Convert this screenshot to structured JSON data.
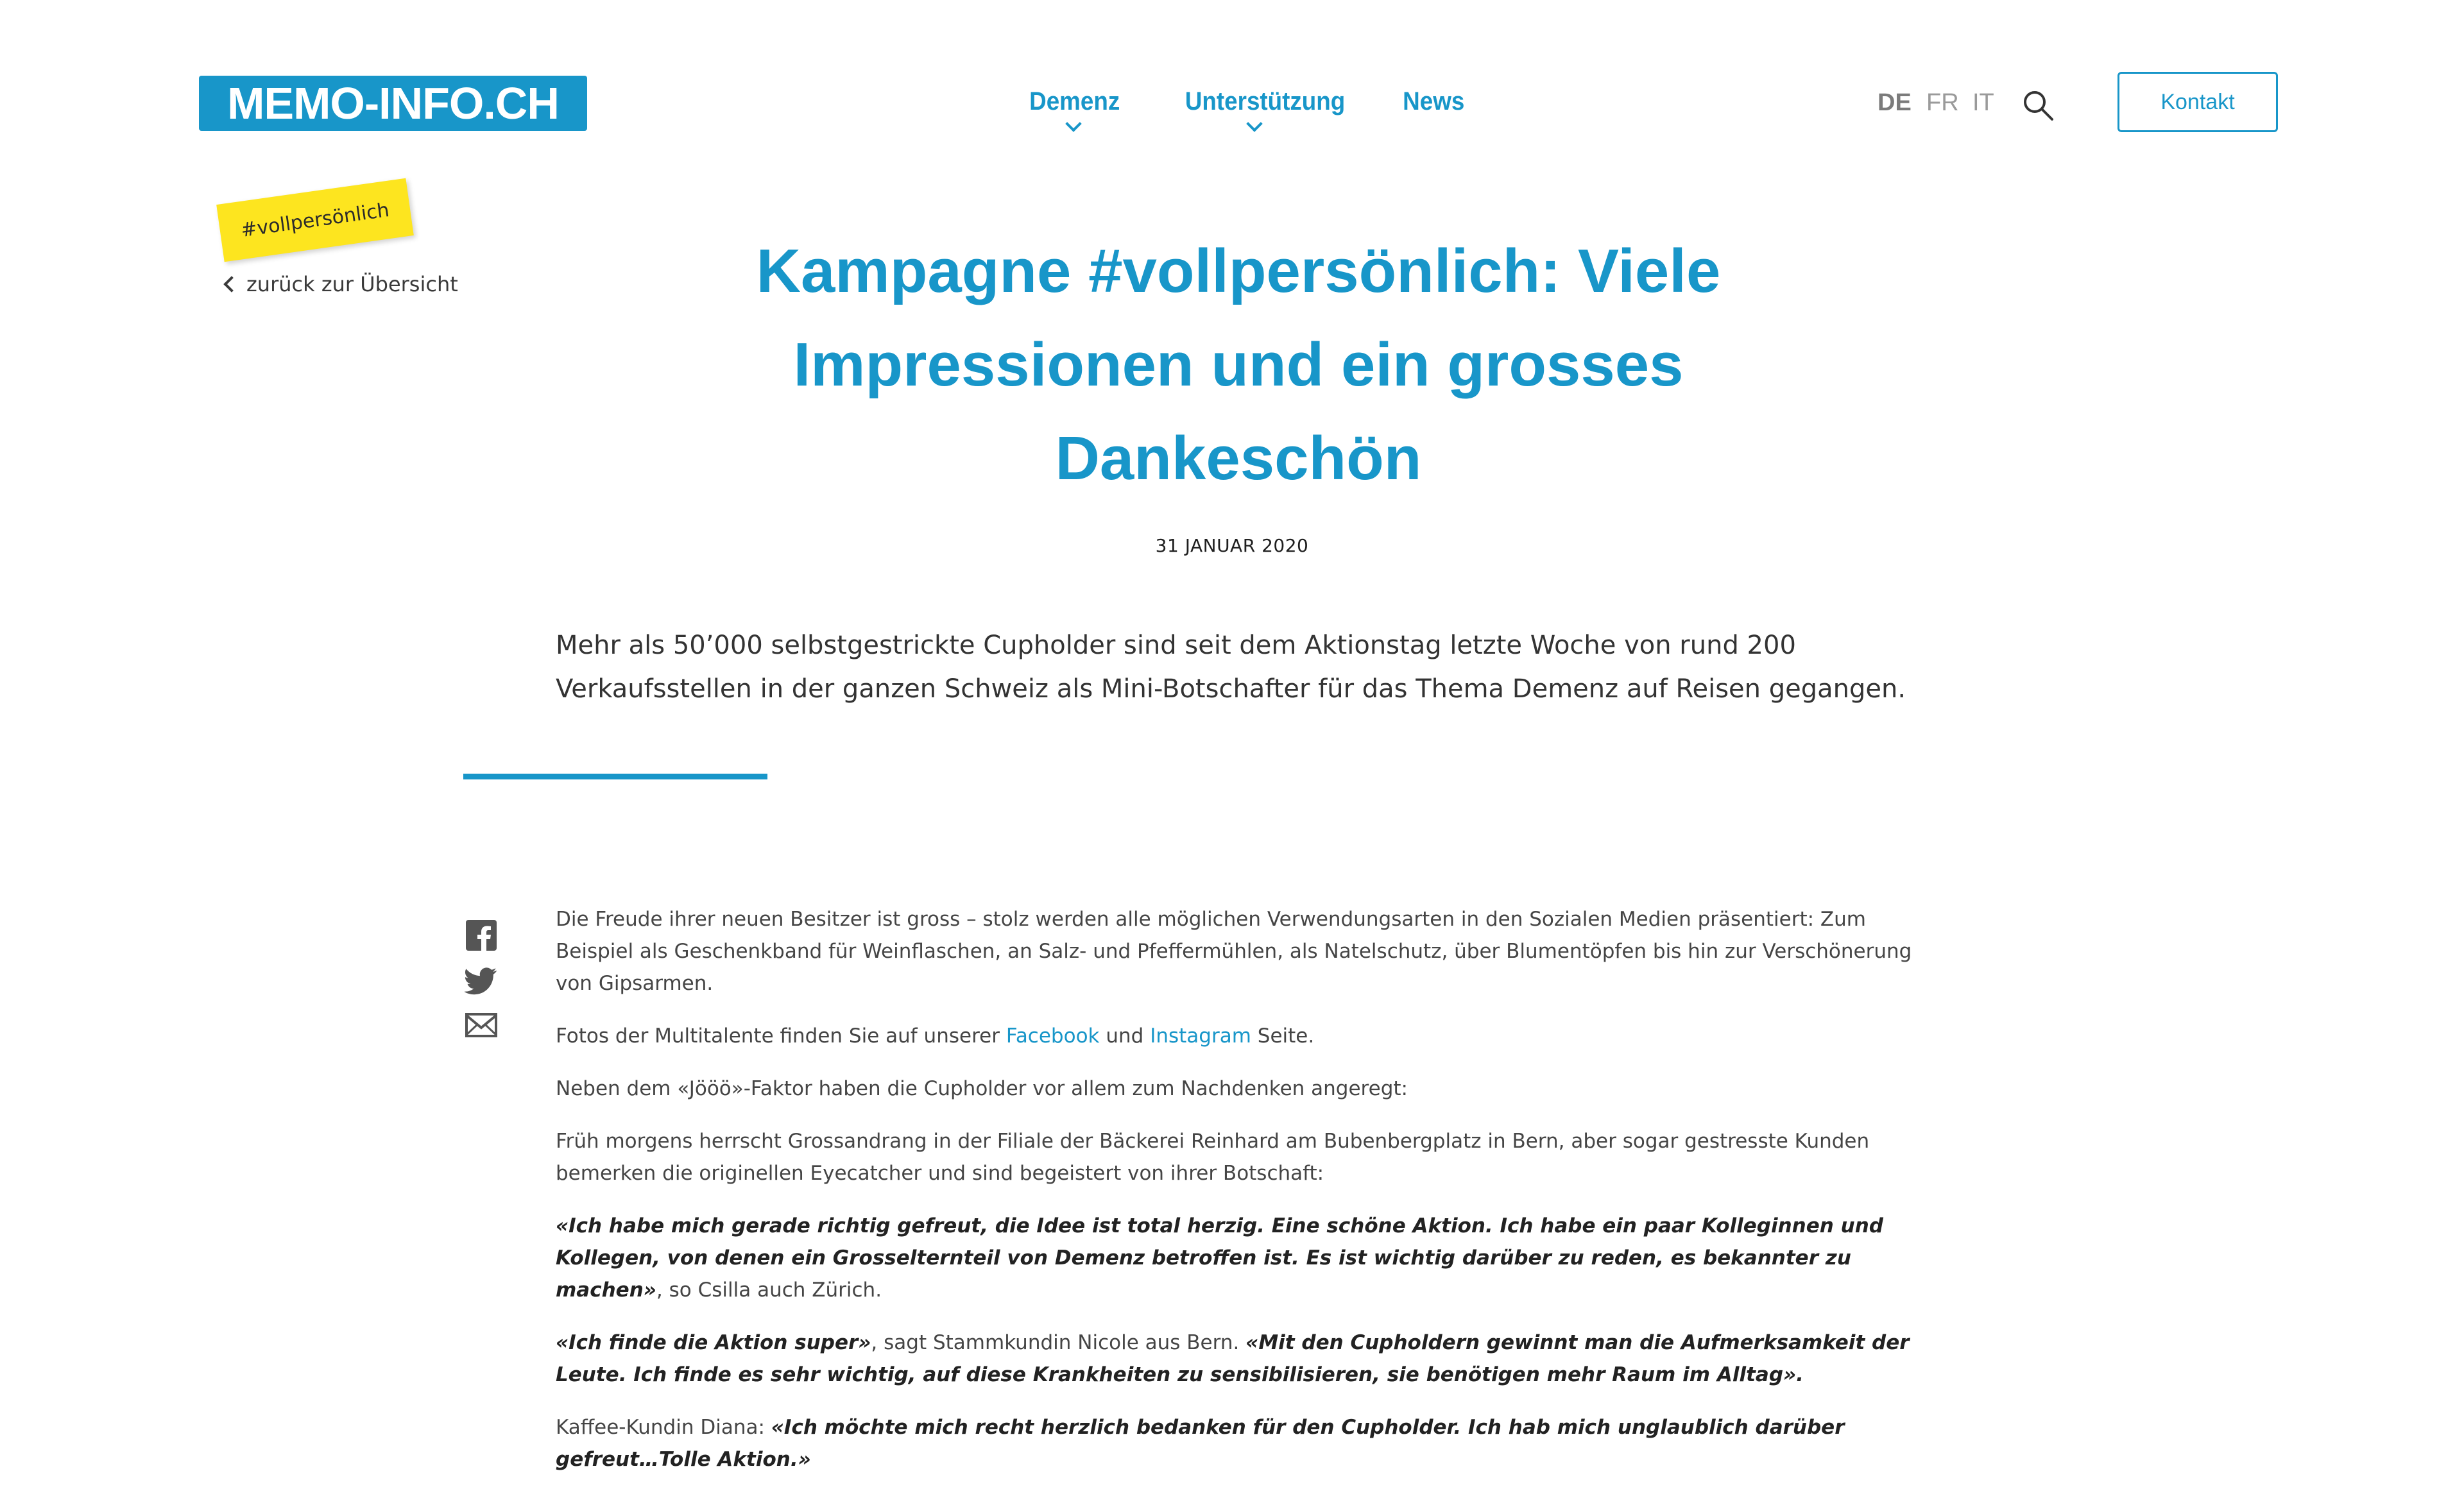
{
  "header": {
    "logo_text": "MEMO-INFO.CH",
    "nav": [
      {
        "label": "Demenz",
        "has_submenu": true
      },
      {
        "label": "Unterstützung",
        "has_submenu": true
      },
      {
        "label": "News",
        "has_submenu": false
      }
    ],
    "languages": [
      {
        "code": "DE",
        "active": true
      },
      {
        "code": "FR",
        "active": false
      },
      {
        "code": "IT",
        "active": false
      }
    ],
    "contact_label": "Kontakt"
  },
  "sidebar": {
    "tag": "#vollpersönlich",
    "back_label": "zurück zur Übersicht"
  },
  "article": {
    "title_lines": [
      "Kampagne #vollpersönlich: Viele",
      "Impressionen und ein grosses",
      "Dankeschön"
    ],
    "date": "31 JANUAR 2020",
    "lead": "Mehr als 50’000 selbstgestrickte Cupholder sind seit dem Aktionstag letzte Woche von rund 200 Verkaufsstellen in der ganzen Schweiz als Mini-Botschafter für das Thema Demenz auf Reisen gegangen.",
    "p1": "Die Freude ihrer neuen Besitzer ist gross – stolz werden alle möglichen Verwendungsarten in den Sozialen Medien präsentiert: Zum Beispiel als Geschenkband für Weinflaschen, an Salz- und Pfeffermühlen, als Natelschutz, über Blumentöpfen bis hin zur Verschönerung von Gipsarmen.",
    "p2_before": "Fotos der Multitalente finden Sie auf unserer ",
    "p2_link1": "Facebook",
    "p2_mid": " und ",
    "p2_link2": "Instagram",
    "p2_after": " Seite.",
    "p3": "Neben dem «Jööö»-Faktor haben die Cupholder vor allem zum Nachdenken angeregt:",
    "p4": "Früh morgens herrscht Grossandrang in der Filiale der Bäckerei Reinhard am Bubenbergplatz in Bern, aber sogar gestresste Kunden bemerken die originellen Eyecatcher und sind begeistert von ihrer Botschaft:",
    "p5_quote": "«Ich habe mich gerade richtig gefreut, die Idee ist total herzig. Eine schöne Aktion. Ich habe ein paar Kolleginnen und Kollegen, von denen ein Grosselternteil von Demenz betroffen ist. Es ist wichtig darüber zu reden, es bekannter zu machen»",
    "p5_after": ", so Csilla auch Zürich.",
    "p6_quote1": "«Ich finde die Aktion super»",
    "p6_mid": ", sagt Stammkundin Nicole aus Bern. ",
    "p6_quote2": "«Mit den Cupholdern gewinnt man die Aufmerksamkeit der Leute. Ich finde es sehr wichtig, auf diese Krankheiten zu sensibilisieren, sie benötigen mehr Raum im Alltag».",
    "p7_before": "Kaffee-Kundin Diana: ",
    "p7_quote": "«Ich möchte mich recht herzlich bedanken für den Cupholder. Ich hab mich unglaublich darüber gefreut…Tolle Aktion.»"
  },
  "share": {
    "icons": [
      "facebook-icon",
      "twitter-icon",
      "email-icon"
    ]
  },
  "colors": {
    "brand_blue": "#1896c9",
    "tag_yellow": "#fde51f"
  }
}
